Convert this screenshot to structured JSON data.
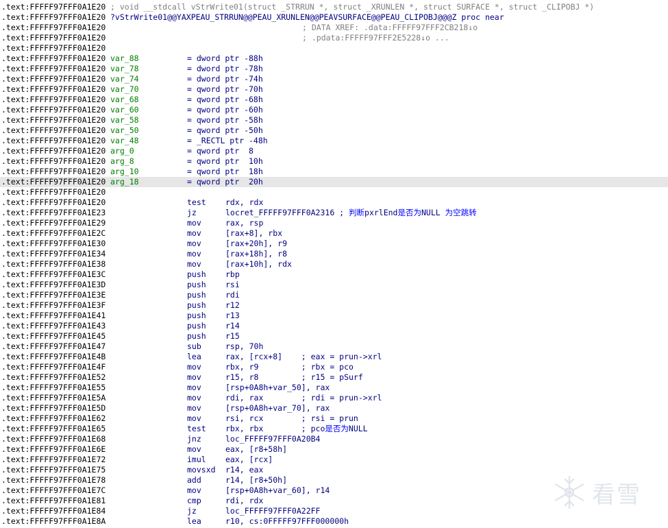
{
  "colors": {
    "address": "#000000",
    "code": "#000080",
    "label": "#008000",
    "comment": "#808080",
    "chinese_comment": "#0000ff",
    "highlight_row": "#e6e6e6"
  },
  "listing": {
    "lines": [
      {
        "addr": ".text:FFFFF97FFF0A1E20",
        "tail": "; void __stdcall vStrWrite01(struct _STRRUN *, struct _XRUNLEN *, struct SURFACE *, struct _CLIPOBJ *)",
        "tail_style": "gray"
      },
      {
        "addr": ".text:FFFFF97FFF0A1E20",
        "tail": "?vStrWrite01@@YAXPEAU_STRRUN@@PEAU_XRUNLEN@@PEAVSURFACE@@PEAU_CLIPOBJ@@@Z proc near"
      },
      {
        "addr": ".text:FFFFF97FFF0A1E20",
        "comment": "; DATA XREF: .data:FFFFF97FFF2CB218↓o"
      },
      {
        "addr": ".text:FFFFF97FFF0A1E20",
        "comment": "; .pdata:FFFFF97FFF2E5228↓o ..."
      },
      {
        "addr": ".text:FFFFF97FFF0A1E20"
      },
      {
        "addr": ".text:FFFFF97FFF0A1E20",
        "label": "var_88",
        "eq": "= dword ptr -88h"
      },
      {
        "addr": ".text:FFFFF97FFF0A1E20",
        "label": "var_78",
        "eq": "= dword ptr -78h"
      },
      {
        "addr": ".text:FFFFF97FFF0A1E20",
        "label": "var_74",
        "eq": "= dword ptr -74h"
      },
      {
        "addr": ".text:FFFFF97FFF0A1E20",
        "label": "var_70",
        "eq": "= qword ptr -70h"
      },
      {
        "addr": ".text:FFFFF97FFF0A1E20",
        "label": "var_68",
        "eq": "= qword ptr -68h"
      },
      {
        "addr": ".text:FFFFF97FFF0A1E20",
        "label": "var_60",
        "eq": "= qword ptr -60h"
      },
      {
        "addr": ".text:FFFFF97FFF0A1E20",
        "label": "var_58",
        "eq": "= qword ptr -58h"
      },
      {
        "addr": ".text:FFFFF97FFF0A1E20",
        "label": "var_50",
        "eq": "= qword ptr -50h"
      },
      {
        "addr": ".text:FFFFF97FFF0A1E20",
        "label": "var_48",
        "eq": "= _RECTL ptr -48h"
      },
      {
        "addr": ".text:FFFFF97FFF0A1E20",
        "label": "arg_0",
        "eq": "= qword ptr  8"
      },
      {
        "addr": ".text:FFFFF97FFF0A1E20",
        "label": "arg_8",
        "eq": "= qword ptr  10h"
      },
      {
        "addr": ".text:FFFFF97FFF0A1E20",
        "label": "arg_10",
        "eq": "= qword ptr  18h"
      },
      {
        "addr": ".text:FFFFF97FFF0A1E20",
        "label": "arg_18",
        "eq": "= qword ptr  20h",
        "highlight": true
      },
      {
        "addr": ".text:FFFFF97FFF0A1E20"
      },
      {
        "addr": ".text:FFFFF97FFF0A1E20",
        "mn": "test",
        "op": "rdx, rdx"
      },
      {
        "addr": ".text:FFFFF97FFF0A1E23",
        "mn": "jz",
        "op": "locret_FFFFF97FFF0A2316 ; 判断pxrlEnd是否为NULL 为空跳转"
      },
      {
        "addr": ".text:FFFFF97FFF0A1E29",
        "mn": "mov",
        "op": "rax, rsp"
      },
      {
        "addr": ".text:FFFFF97FFF0A1E2C",
        "mn": "mov",
        "op": "[rax+8], rbx"
      },
      {
        "addr": ".text:FFFFF97FFF0A1E30",
        "mn": "mov",
        "op": "[rax+20h], r9"
      },
      {
        "addr": ".text:FFFFF97FFF0A1E34",
        "mn": "mov",
        "op": "[rax+18h], r8"
      },
      {
        "addr": ".text:FFFFF97FFF0A1E38",
        "mn": "mov",
        "op": "[rax+10h], rdx"
      },
      {
        "addr": ".text:FFFFF97FFF0A1E3C",
        "mn": "push",
        "op": "rbp"
      },
      {
        "addr": ".text:FFFFF97FFF0A1E3D",
        "mn": "push",
        "op": "rsi"
      },
      {
        "addr": ".text:FFFFF97FFF0A1E3E",
        "mn": "push",
        "op": "rdi"
      },
      {
        "addr": ".text:FFFFF97FFF0A1E3F",
        "mn": "push",
        "op": "r12"
      },
      {
        "addr": ".text:FFFFF97FFF0A1E41",
        "mn": "push",
        "op": "r13"
      },
      {
        "addr": ".text:FFFFF97FFF0A1E43",
        "mn": "push",
        "op": "r14"
      },
      {
        "addr": ".text:FFFFF97FFF0A1E45",
        "mn": "push",
        "op": "r15"
      },
      {
        "addr": ".text:FFFFF97FFF0A1E47",
        "mn": "sub",
        "op": "rsp, 70h"
      },
      {
        "addr": ".text:FFFFF97FFF0A1E4B",
        "mn": "lea",
        "op": "rax, [rcx+8]    ; eax = prun->xrl"
      },
      {
        "addr": ".text:FFFFF97FFF0A1E4F",
        "mn": "mov",
        "op": "rbx, r9         ; rbx = pco"
      },
      {
        "addr": ".text:FFFFF97FFF0A1E52",
        "mn": "mov",
        "op": "r15, r8         ; r15 = pSurf"
      },
      {
        "addr": ".text:FFFFF97FFF0A1E55",
        "mn": "mov",
        "op": "[rsp+0A8h+var_50], rax"
      },
      {
        "addr": ".text:FFFFF97FFF0A1E5A",
        "mn": "mov",
        "op": "rdi, rax        ; rdi = prun->xrl"
      },
      {
        "addr": ".text:FFFFF97FFF0A1E5D",
        "mn": "mov",
        "op": "[rsp+0A8h+var_70], rax"
      },
      {
        "addr": ".text:FFFFF97FFF0A1E62",
        "mn": "mov",
        "op": "rsi, rcx        ; rsi = prun"
      },
      {
        "addr": ".text:FFFFF97FFF0A1E65",
        "mn": "test",
        "op": "rbx, rbx        ; pco是否为NULL"
      },
      {
        "addr": ".text:FFFFF97FFF0A1E68",
        "mn": "jnz",
        "op": "loc_FFFFF97FFF0A20B4"
      },
      {
        "addr": ".text:FFFFF97FFF0A1E6E",
        "mn": "mov",
        "op": "eax, [r8+58h]"
      },
      {
        "addr": ".text:FFFFF97FFF0A1E72",
        "mn": "imul",
        "op": "eax, [rcx]"
      },
      {
        "addr": ".text:FFFFF97FFF0A1E75",
        "mn": "movsxd",
        "op": "r14, eax"
      },
      {
        "addr": ".text:FFFFF97FFF0A1E78",
        "mn": "add",
        "op": "r14, [r8+50h]"
      },
      {
        "addr": ".text:FFFFF97FFF0A1E7C",
        "mn": "mov",
        "op": "[rsp+0A8h+var_60], r14"
      },
      {
        "addr": ".text:FFFFF97FFF0A1E81",
        "mn": "cmp",
        "op": "rdi, rdx"
      },
      {
        "addr": ".text:FFFFF97FFF0A1E84",
        "mn": "jz",
        "op": "loc_FFFFF97FFF0A22FF"
      },
      {
        "addr": ".text:FFFFF97FFF0A1E8A",
        "mn": "lea",
        "op": "r10, cs:0FFFFF97FFF000000h"
      }
    ]
  },
  "watermark": {
    "icon": "snowflake-icon",
    "text": "看雪"
  }
}
